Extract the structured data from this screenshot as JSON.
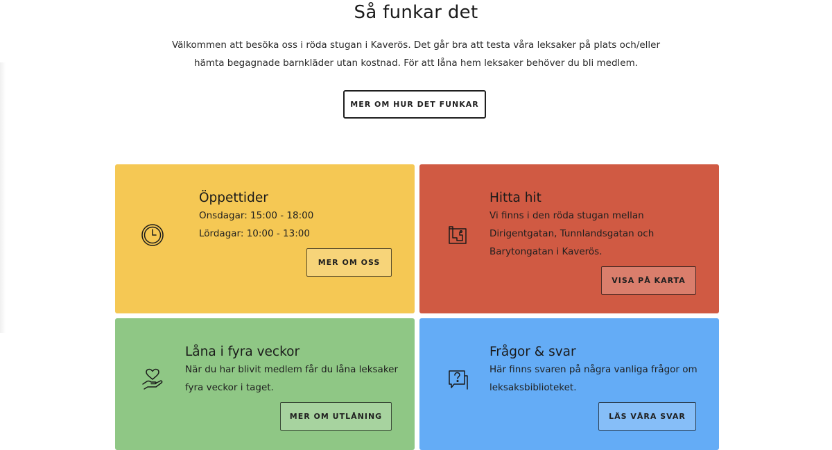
{
  "section": {
    "heading": "Så funkar det",
    "intro_line1": "Välkommen att besöka oss i röda stugan i Kaverös. Det går bra att testa våra leksaker på plats och/eller",
    "intro_line2": "hämta begagnade barnkläder utan kostnad. För att låna hem leksaker behöver du bli medlem.",
    "button_label": "MER OM HUR DET FUNKAR"
  },
  "cards": [
    {
      "title": "Öppettider",
      "lines": [
        "Onsdagar: 15:00 - 18:00",
        "Lördagar: 10:00 - 13:00"
      ],
      "button_label": "MER OM OSS",
      "icon": "clock-icon",
      "color": "#f5c854"
    },
    {
      "title": "Hitta hit",
      "lines": [
        "Vi finns i den röda stugan mellan",
        "Dirigentgatan, Tunnlandsgatan och",
        "Barytongatan i Kaverös."
      ],
      "button_label": "VISA PÅ KARTA",
      "icon": "map-icon",
      "color": "#d05a43"
    },
    {
      "title": "Låna i fyra veckor",
      "lines": [
        "När du har blivit medlem får du låna leksaker",
        "fyra veckor i taget."
      ],
      "button_label": "MER OM UTLÅNING",
      "icon": "heart-hand-icon",
      "color": "#8fc785"
    },
    {
      "title": "Frågor & svar",
      "lines": [
        "Här finns svaren på några vanliga frågor om",
        "leksaksbiblioteket."
      ],
      "button_label": "LÄS VÅRA SVAR",
      "icon": "question-chat-icon",
      "color": "#64acf6"
    }
  ]
}
